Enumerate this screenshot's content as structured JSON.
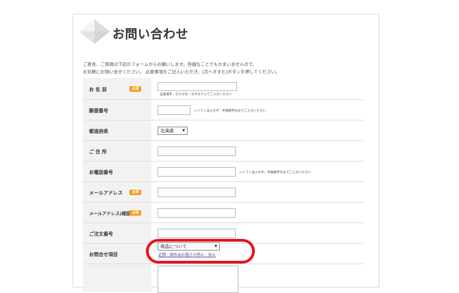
{
  "page": {
    "title": "お問い合わせ",
    "intro_line1": "ご意見、ご質問は下記のフォームからお願いします。些細なことでもかまいませんので、",
    "intro_line2": "お気軽にお問い合せください。 必要事項をご記入いただき、[次へすすむ]ボタンを押してください。"
  },
  "form": {
    "required_badge": "必須",
    "name": {
      "label": "お 名 前",
      "value": "",
      "note": "全角漢字・ひらがな・カタカナにてご入力ください"
    },
    "postal": {
      "label": "郵便番号",
      "value": "",
      "note": "ハイフンは入れず、半角数字のみでご入力ください"
    },
    "prefecture": {
      "label": "都道府県",
      "selected": "北海道"
    },
    "address": {
      "label": "ご 住 所",
      "value": ""
    },
    "phone": {
      "label": "お電話番号",
      "value": "",
      "note": "ハイフンは入れず、半角数字のみでご入力ください"
    },
    "email": {
      "label": "メールアドレス",
      "value": ""
    },
    "email_confirm": {
      "label": "メールアドレス(確認)",
      "value": ""
    },
    "order_number": {
      "label": "ご注文番号",
      "value": ""
    },
    "inquiry": {
      "label": "お問合せ項目",
      "selected": "商品について",
      "link": "定期・頒布会お届けの停止・休止"
    },
    "message": {
      "value": ""
    }
  },
  "colors": {
    "accent": "#f39a16",
    "highlight": "#e8131a",
    "link": "#5a4a9c",
    "label_bg": "#f2f2f2"
  }
}
